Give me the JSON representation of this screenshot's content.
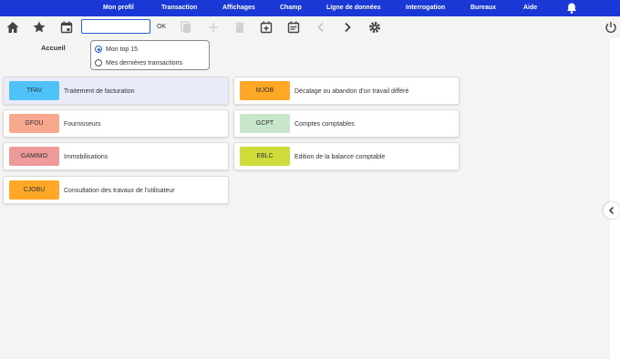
{
  "nav": {
    "items": [
      {
        "label": "Mon profil"
      },
      {
        "label": "Transaction"
      },
      {
        "label": "Affichages"
      },
      {
        "label": "Champ"
      },
      {
        "label": "Ligne de données"
      },
      {
        "label": "Interrogation"
      },
      {
        "label": "Bureaux"
      },
      {
        "label": "Aide"
      }
    ],
    "notification_icon": "bell-icon",
    "background_color": "#1a38d6"
  },
  "toolbar": {
    "transaction_value": "",
    "ok_label": "OK",
    "icons": [
      "home-icon",
      "star-icon",
      "calendar-icon",
      "copy-icon",
      "add-icon",
      "delete-icon",
      "calendar-add-icon",
      "calendar-list-icon",
      "chevron-left-icon",
      "chevron-right-icon",
      "gear-icon",
      "power-icon"
    ]
  },
  "accueil": {
    "label": "Accueil",
    "options": [
      {
        "label": "Mon top 15",
        "selected": true
      },
      {
        "label": "Mes dernières transactions",
        "selected": false
      }
    ]
  },
  "cards": [
    {
      "code": "TFAV",
      "description": "Traitement de facturation",
      "color": "#4fc3f7",
      "active": true
    },
    {
      "code": "MJOB",
      "description": "Décalage ou abandon d'un travail différé",
      "color": "#ffa726",
      "active": false
    },
    {
      "code": "GFOU",
      "description": "Fournisseurs",
      "color": "#f8a88e",
      "active": false
    },
    {
      "code": "GCPT",
      "description": "Comptes comptables",
      "color": "#c8e6c9",
      "active": false
    },
    {
      "code": "GAMIMO",
      "description": "Immobilisations",
      "color": "#ef9a9a",
      "active": false
    },
    {
      "code": "EBLC",
      "description": "Edition de la balance comptable",
      "color": "#cddc39",
      "active": false
    },
    {
      "code": "CJOBU",
      "description": "Consultation des travaux de l'utilisateur",
      "color": "#ffa726",
      "active": false
    }
  ],
  "side_panel": {
    "toggle_icon": "chevron-left-icon"
  }
}
